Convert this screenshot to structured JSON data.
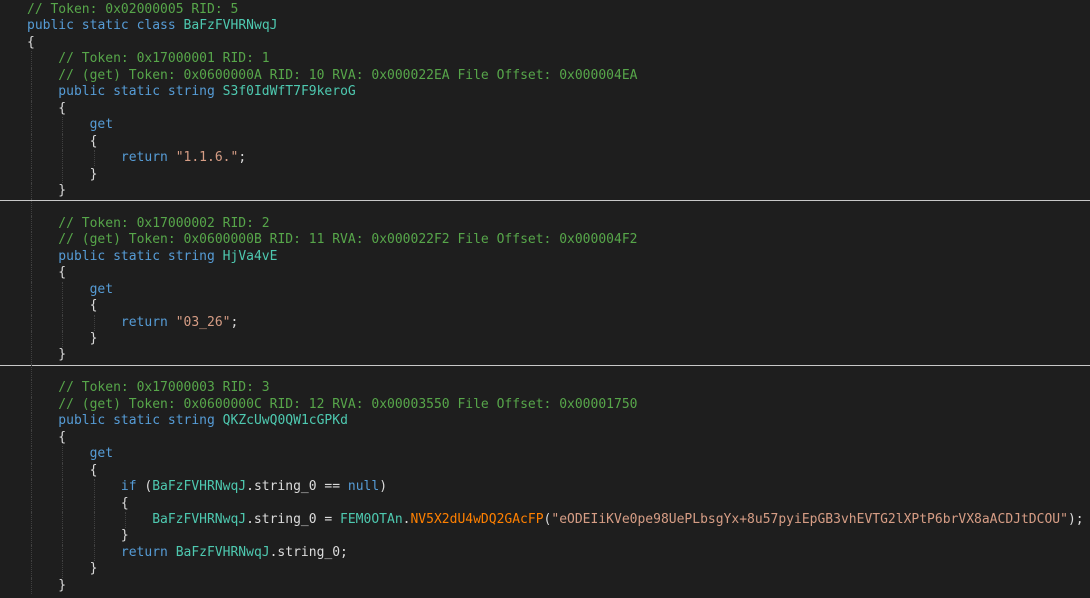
{
  "lines": [
    {
      "indent": 0,
      "guides": 0,
      "tokens": [
        {
          "t": "c",
          "v": "// Token: 0x02000005 RID: 5"
        }
      ]
    },
    {
      "indent": 0,
      "guides": 0,
      "tokens": [
        {
          "t": "k",
          "v": "public static class "
        },
        {
          "t": "id",
          "v": "BaFzFVHRNwqJ"
        }
      ]
    },
    {
      "indent": 0,
      "guides": 0,
      "tokens": [
        {
          "t": "p",
          "v": "{"
        }
      ]
    },
    {
      "indent": 1,
      "guides": 1,
      "tokens": [
        {
          "t": "c",
          "v": "// Token: 0x17000001 RID: 1"
        }
      ]
    },
    {
      "indent": 1,
      "guides": 1,
      "tokens": [
        {
          "t": "c",
          "v": "// (get) Token: 0x0600000A RID: 10 RVA: 0x000022EA File Offset: 0x000004EA"
        }
      ]
    },
    {
      "indent": 1,
      "guides": 1,
      "tokens": [
        {
          "t": "k",
          "v": "public static string "
        },
        {
          "t": "id",
          "v": "S3f0IdWfT7F9keroG"
        }
      ]
    },
    {
      "indent": 1,
      "guides": 1,
      "tokens": [
        {
          "t": "p",
          "v": "{"
        }
      ]
    },
    {
      "indent": 2,
      "guides": 2,
      "tokens": [
        {
          "t": "k",
          "v": "get"
        }
      ]
    },
    {
      "indent": 2,
      "guides": 2,
      "tokens": [
        {
          "t": "p",
          "v": "{"
        }
      ]
    },
    {
      "indent": 3,
      "guides": 3,
      "tokens": [
        {
          "t": "k",
          "v": "return "
        },
        {
          "t": "s",
          "v": "\"1.1.6.\""
        },
        {
          "t": "p",
          "v": ";"
        }
      ]
    },
    {
      "indent": 2,
      "guides": 2,
      "tokens": [
        {
          "t": "p",
          "v": "}"
        }
      ]
    },
    {
      "indent": 1,
      "guides": 1,
      "tokens": [
        {
          "t": "p",
          "v": "}"
        }
      ],
      "sep": true
    },
    {
      "indent": 0,
      "guides": 1,
      "tokens": []
    },
    {
      "indent": 1,
      "guides": 1,
      "tokens": [
        {
          "t": "c",
          "v": "// Token: 0x17000002 RID: 2"
        }
      ]
    },
    {
      "indent": 1,
      "guides": 1,
      "tokens": [
        {
          "t": "c",
          "v": "// (get) Token: 0x0600000B RID: 11 RVA: 0x000022F2 File Offset: 0x000004F2"
        }
      ]
    },
    {
      "indent": 1,
      "guides": 1,
      "tokens": [
        {
          "t": "k",
          "v": "public static string "
        },
        {
          "t": "id",
          "v": "HjVa4vE"
        }
      ]
    },
    {
      "indent": 1,
      "guides": 1,
      "tokens": [
        {
          "t": "p",
          "v": "{"
        }
      ]
    },
    {
      "indent": 2,
      "guides": 2,
      "tokens": [
        {
          "t": "k",
          "v": "get"
        }
      ]
    },
    {
      "indent": 2,
      "guides": 2,
      "tokens": [
        {
          "t": "p",
          "v": "{"
        }
      ]
    },
    {
      "indent": 3,
      "guides": 3,
      "tokens": [
        {
          "t": "k",
          "v": "return "
        },
        {
          "t": "s",
          "v": "\"03_26\""
        },
        {
          "t": "p",
          "v": ";"
        }
      ]
    },
    {
      "indent": 2,
      "guides": 2,
      "tokens": [
        {
          "t": "p",
          "v": "}"
        }
      ]
    },
    {
      "indent": 1,
      "guides": 1,
      "tokens": [
        {
          "t": "p",
          "v": "}"
        }
      ],
      "sep": true
    },
    {
      "indent": 0,
      "guides": 1,
      "tokens": []
    },
    {
      "indent": 1,
      "guides": 1,
      "tokens": [
        {
          "t": "c",
          "v": "// Token: 0x17000003 RID: 3"
        }
      ]
    },
    {
      "indent": 1,
      "guides": 1,
      "tokens": [
        {
          "t": "c",
          "v": "// (get) Token: 0x0600000C RID: 12 RVA: 0x00003550 File Offset: 0x00001750"
        }
      ]
    },
    {
      "indent": 1,
      "guides": 1,
      "tokens": [
        {
          "t": "k",
          "v": "public static string "
        },
        {
          "t": "id",
          "v": "QKZcUwQ0QW1cGPKd"
        }
      ]
    },
    {
      "indent": 1,
      "guides": 1,
      "tokens": [
        {
          "t": "p",
          "v": "{"
        }
      ]
    },
    {
      "indent": 2,
      "guides": 2,
      "tokens": [
        {
          "t": "k",
          "v": "get"
        }
      ]
    },
    {
      "indent": 2,
      "guides": 2,
      "tokens": [
        {
          "t": "p",
          "v": "{"
        }
      ]
    },
    {
      "indent": 3,
      "guides": 3,
      "tokens": [
        {
          "t": "k",
          "v": "if "
        },
        {
          "t": "p",
          "v": "("
        },
        {
          "t": "id",
          "v": "BaFzFVHRNwqJ"
        },
        {
          "t": "p",
          "v": ".string_0 == "
        },
        {
          "t": "k",
          "v": "null"
        },
        {
          "t": "p",
          "v": ")"
        }
      ]
    },
    {
      "indent": 3,
      "guides": 3,
      "tokens": [
        {
          "t": "p",
          "v": "{"
        }
      ]
    },
    {
      "indent": 4,
      "guides": 4,
      "tokens": [
        {
          "t": "id",
          "v": "BaFzFVHRNwqJ"
        },
        {
          "t": "p",
          "v": ".string_0 = "
        },
        {
          "t": "id",
          "v": "FEM0OTAn"
        },
        {
          "t": "p",
          "v": "."
        },
        {
          "t": "m",
          "v": "NV5X2dU4wDQ2GAcFP"
        },
        {
          "t": "p",
          "v": "("
        },
        {
          "t": "s",
          "v": "\"eODEIiKVe0pe98UePLbsgYx+8u57pyiEpGB3vhEVTG2lXPtP6brVX8aACDJtDCOU\""
        },
        {
          "t": "p",
          "v": ");"
        }
      ]
    },
    {
      "indent": 3,
      "guides": 3,
      "tokens": [
        {
          "t": "p",
          "v": "}"
        }
      ]
    },
    {
      "indent": 3,
      "guides": 3,
      "tokens": [
        {
          "t": "k",
          "v": "return "
        },
        {
          "t": "id",
          "v": "BaFzFVHRNwqJ"
        },
        {
          "t": "p",
          "v": ".string_0;"
        }
      ]
    },
    {
      "indent": 2,
      "guides": 2,
      "tokens": [
        {
          "t": "p",
          "v": "}"
        }
      ]
    },
    {
      "indent": 1,
      "guides": 1,
      "tokens": [
        {
          "t": "p",
          "v": "}"
        }
      ]
    }
  ]
}
